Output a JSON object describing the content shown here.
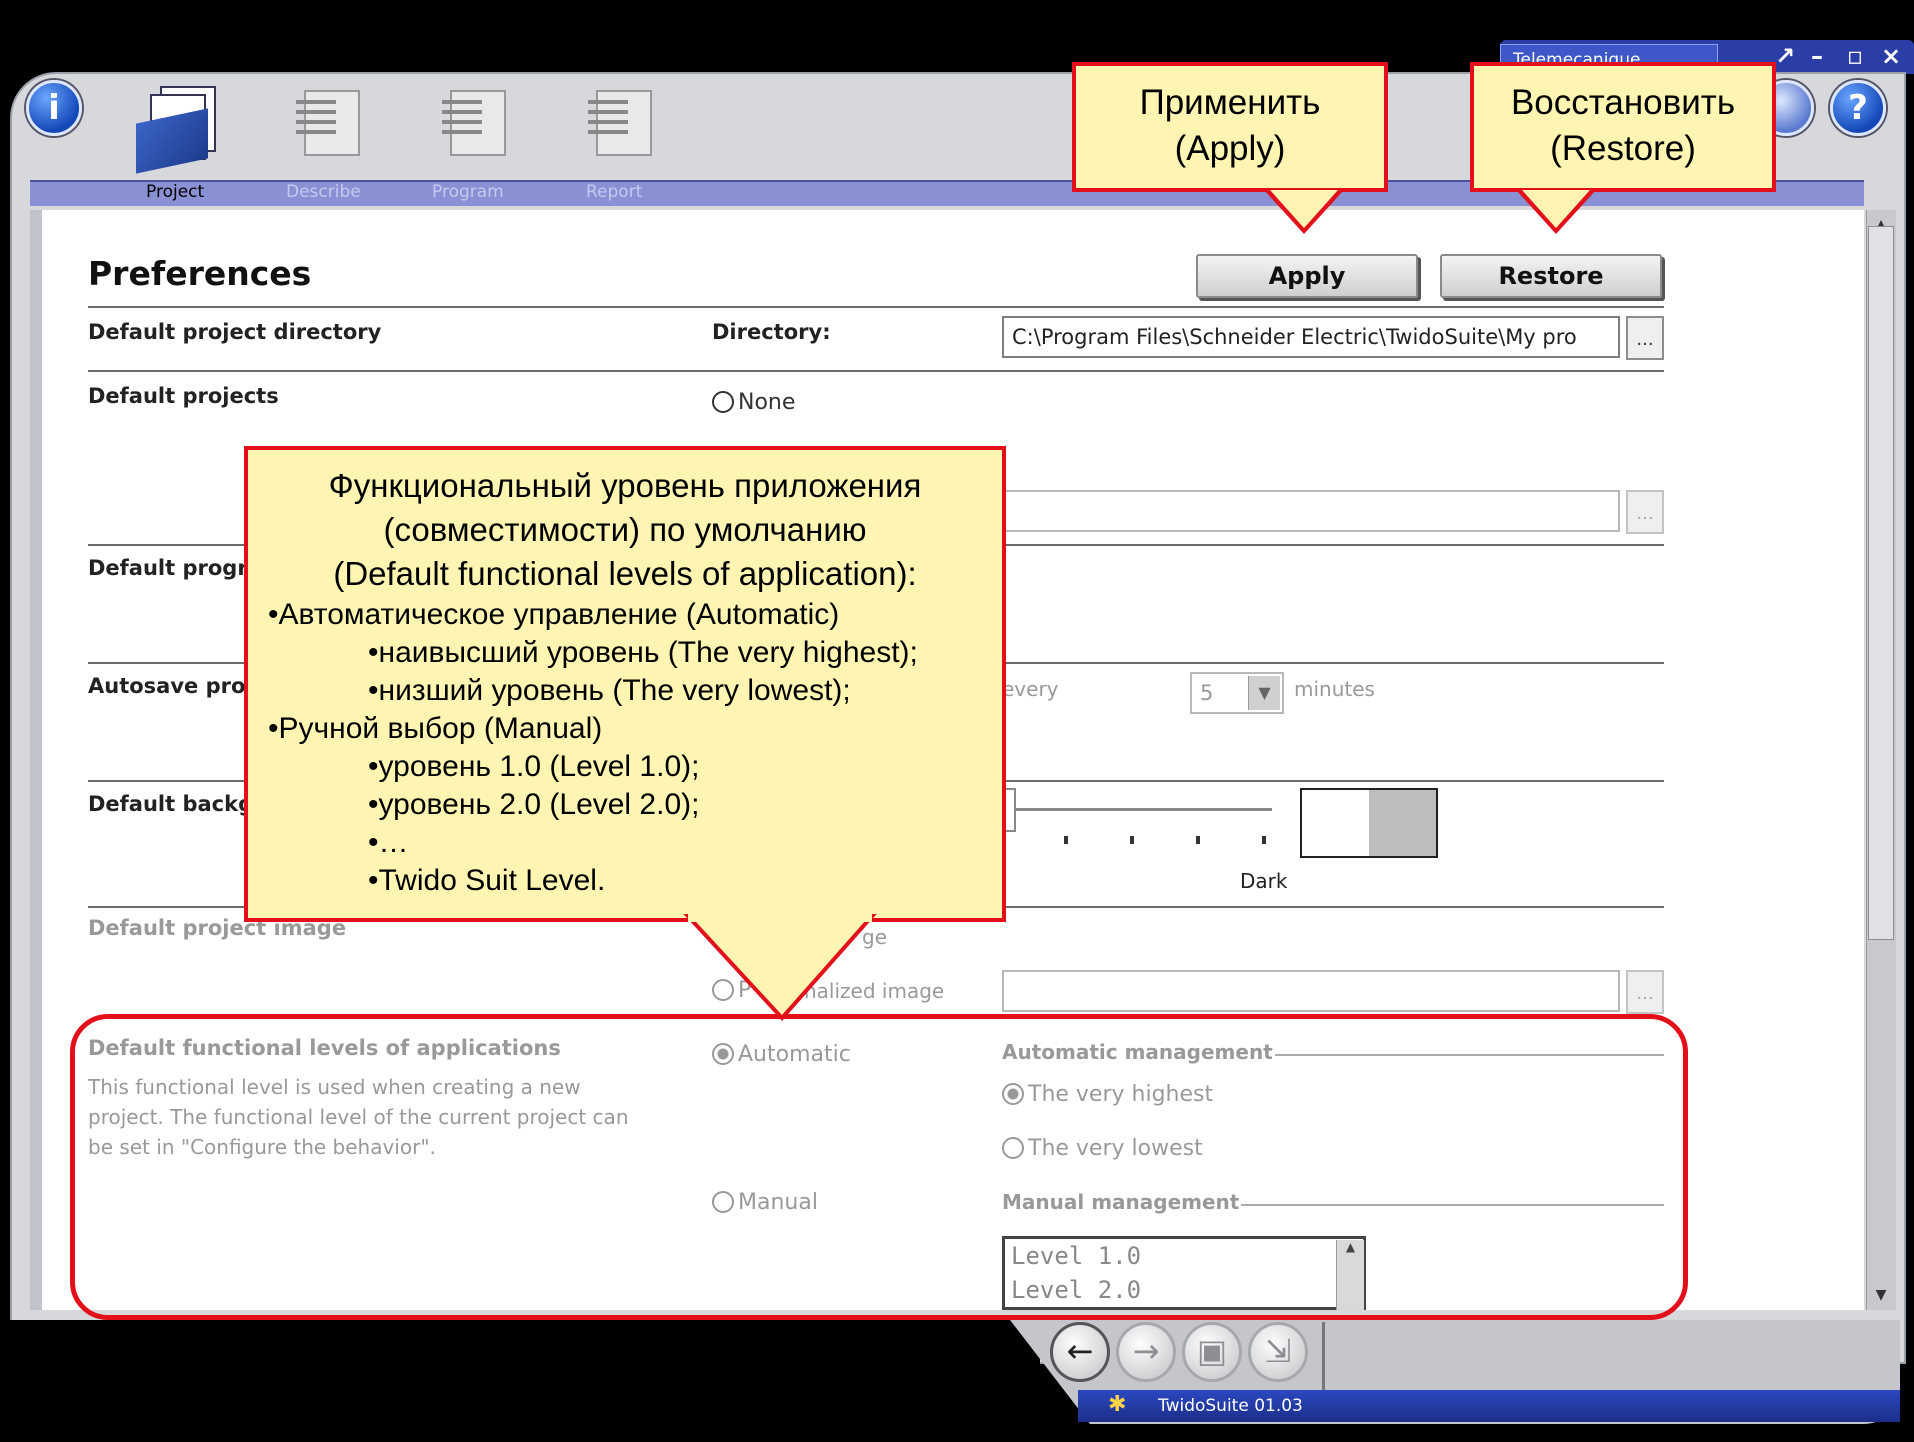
{
  "window": {
    "brand": "Telemecanique",
    "controls": [
      "↗",
      "–",
      "▫",
      "×"
    ]
  },
  "toolbar": {
    "info_symbol": "i",
    "help_symbol": "?",
    "steps": [
      {
        "label": "Project",
        "active": true
      },
      {
        "label": "Describe",
        "active": false
      },
      {
        "label": "Program",
        "active": false
      },
      {
        "label": "Report",
        "active": false
      }
    ]
  },
  "page": {
    "title": "Preferences",
    "apply_label": "Apply",
    "restore_label": "Restore"
  },
  "rows": {
    "directory": {
      "label": "Default project directory",
      "field_label": "Directory:",
      "value": "C:\\Program Files\\Schneider Electric\\TwidoSuite\\My pro",
      "browse": "..."
    },
    "projects": {
      "label": "Default projects",
      "option_none": "None",
      "browse": "..."
    },
    "progr": {
      "label": "Default progr"
    },
    "autosave": {
      "label": "Autosave pro",
      "every": "every",
      "minutes_value": "5",
      "minutes_label": "minutes"
    },
    "background": {
      "label": "Default backg",
      "dark_label": "Dark"
    },
    "image": {
      "label": "Default project image",
      "option_default_partial": "ge",
      "option_personalized_partial": "nalized image",
      "option_personalized_first": "P",
      "browse": "..."
    },
    "functional": {
      "label": "Default functional levels of applications",
      "description_lines": [
        "This functional level is used when creating a new",
        "project. The functional level of the current project can",
        "be set in \"Configure the behavior\"."
      ],
      "option_automatic": "Automatic",
      "option_manual": "Manual",
      "auto_group": "Automatic management",
      "auto_highest": "The very highest",
      "auto_lowest": "The very lowest",
      "manual_group": "Manual management",
      "levels": [
        "Level 1.0",
        "Level 2.0"
      ]
    }
  },
  "callouts": {
    "apply": [
      "Применить",
      "(Apply)"
    ],
    "restore": [
      "Восстановить",
      "(Restore)"
    ],
    "main": {
      "title_lines": [
        "Функциональный уровень приложения",
        "(совместимости) по умолчанию",
        "(Default functional levels of application):"
      ],
      "items": [
        {
          "text": "•Автоматическое управление (Automatic)",
          "indent": 1
        },
        {
          "text": "•наивысший уровень (The very highest);",
          "indent": 2
        },
        {
          "text": "•низший уровень (The very lowest);",
          "indent": 2
        },
        {
          "text": "•Ручной выбор (Manual)",
          "indent": 1
        },
        {
          "text": "•уровень 1.0 (Level 1.0);",
          "indent": 2
        },
        {
          "text": "•уровень 2.0 (Level 2.0);",
          "indent": 2
        },
        {
          "text": "•…",
          "indent": 2
        },
        {
          "text": "•Twido Suit Level.",
          "indent": 2
        }
      ]
    }
  },
  "bottom_nav": {
    "buttons": [
      {
        "name": "back",
        "symbol": "←",
        "enabled": true
      },
      {
        "name": "forward",
        "symbol": "→",
        "enabled": false
      },
      {
        "name": "save",
        "symbol": "▣",
        "enabled": false
      },
      {
        "name": "export",
        "symbol": "⇲",
        "enabled": false
      }
    ],
    "status": "TwidoSuite 01.03"
  },
  "colors": {
    "callout_border": "#e3101c",
    "callout_fill": "#fff5b2",
    "step_bar": "#8a90d4"
  }
}
